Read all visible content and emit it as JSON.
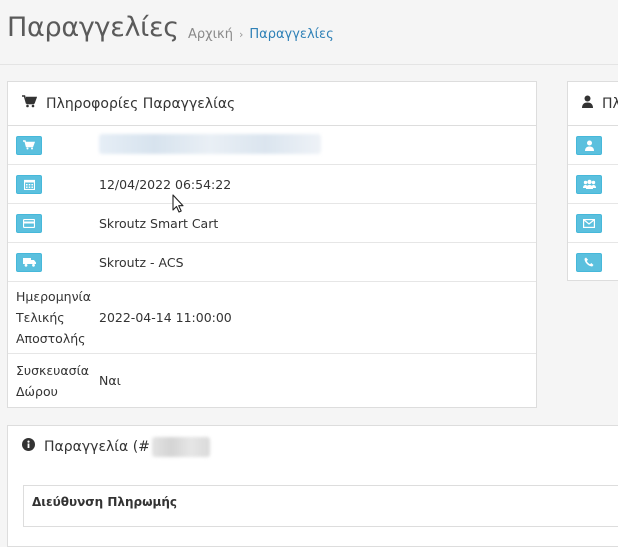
{
  "header": {
    "title": "Παραγγελίες",
    "breadcrumb_home": "Αρχική",
    "breadcrumb_current": "Παραγγελίες"
  },
  "order_info": {
    "title": "Πληροφορίες Παραγγελίας",
    "date_added": "12/04/2022 06:54:22",
    "payment_method": "Skroutz Smart Cart",
    "shipping_method": "Skroutz - ACS",
    "final_shipping_date_label": "Ημερομηνία Τελικής Αποστολής",
    "final_shipping_date": "2022-04-14 11:00:00",
    "gift_wrap_label": "Συσκευασία Δώρου",
    "gift_wrap_value": "Ναι"
  },
  "customer": {
    "title_partial": "Πλ"
  },
  "order": {
    "title_prefix": "Παραγγελία (#"
  },
  "payment_address": {
    "header": "Διεύθυνση Πληρωμής"
  },
  "icons": [
    "cart-icon",
    "calendar-icon",
    "credit-card-icon",
    "truck-icon",
    "user-icon",
    "group-icon",
    "envelope-icon",
    "phone-icon",
    "info-icon"
  ],
  "colors": {
    "icon_button": "#5bc0de",
    "breadcrumb_active": "#2f81b7"
  }
}
